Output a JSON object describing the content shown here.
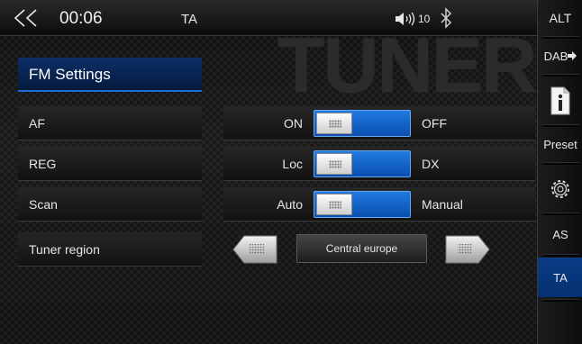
{
  "status_bar": {
    "clock": "00:06",
    "ta": "TA",
    "volume": "10",
    "icons": [
      "back-arrow-icon",
      "volume-icon",
      "bluetooth-icon"
    ]
  },
  "watermark": "TUNER",
  "settings": {
    "title": "FM Settings",
    "rows": [
      {
        "label": "AF",
        "option_left": "ON",
        "option_right": "OFF"
      },
      {
        "label": "REG",
        "option_left": "Loc",
        "option_right": "DX"
      },
      {
        "label": "Scan",
        "option_left": "Auto",
        "option_right": "Manual"
      },
      {
        "label": "Tuner region",
        "value": "Central europe"
      }
    ]
  },
  "rail": {
    "alt": "ALT",
    "dab": "DAB",
    "info_icon": "info-icon",
    "preset": "Preset",
    "settings_icon": "gear-icon",
    "as": "AS",
    "ta": "TA"
  },
  "colors": {
    "accent_blue": "#1f7ae0",
    "selected_bg": "#0d2f66",
    "background": "#161616"
  }
}
